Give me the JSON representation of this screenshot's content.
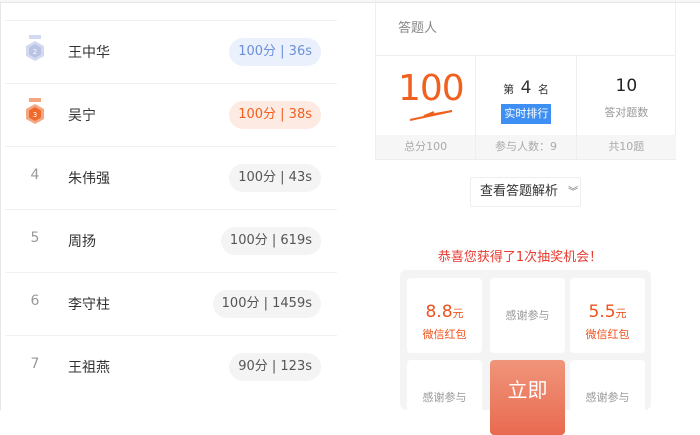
{
  "ranking": [
    {
      "rank": "2",
      "medal": "silver",
      "name": "王中华",
      "score": "100分",
      "time": "36s",
      "badge_bg": "#eaf1fd",
      "badge_color": "#6c8fd8"
    },
    {
      "rank": "3",
      "medal": "bronze",
      "name": "吴宁",
      "score": "100分",
      "time": "38s",
      "badge_bg": "#fdeae3",
      "badge_color": "#f0601f"
    },
    {
      "rank": "4",
      "name": "朱伟强",
      "score": "100分",
      "time": "43s"
    },
    {
      "rank": "5",
      "name": "周扬",
      "score": "100分",
      "time": "619s"
    },
    {
      "rank": "6",
      "name": "李守柱",
      "score": "100分",
      "time": "1459s"
    },
    {
      "rank": "7",
      "name": "王祖燕",
      "score": "90分",
      "time": "123s"
    }
  ],
  "result": {
    "respondent_label": "答题人",
    "score": "100",
    "score_foot": "总分100",
    "rank_prefix": "第",
    "rank": "4",
    "rank_suffix": "名",
    "realtime_button": "实时排行",
    "participants": "参与人数：9",
    "correct": "10",
    "correct_label": "答对题数",
    "total": "共10题",
    "analysis_button": "查看答题解析"
  },
  "lottery": {
    "congrats": "恭喜您获得了1次抽奖机会！",
    "prizes": [
      {
        "amount": "8.8",
        "unit": "元",
        "label": "微信红包"
      },
      {
        "thanks": "感谢参与"
      },
      {
        "amount": "5.5",
        "unit": "元",
        "label": "微信红包"
      },
      {
        "thanks": "感谢参与"
      },
      {
        "go": "立即"
      },
      {
        "thanks": "感谢参与"
      }
    ]
  },
  "colors": {
    "accent": "#f0601f",
    "blue": "#3d8ff3",
    "red": "#e8392f"
  }
}
